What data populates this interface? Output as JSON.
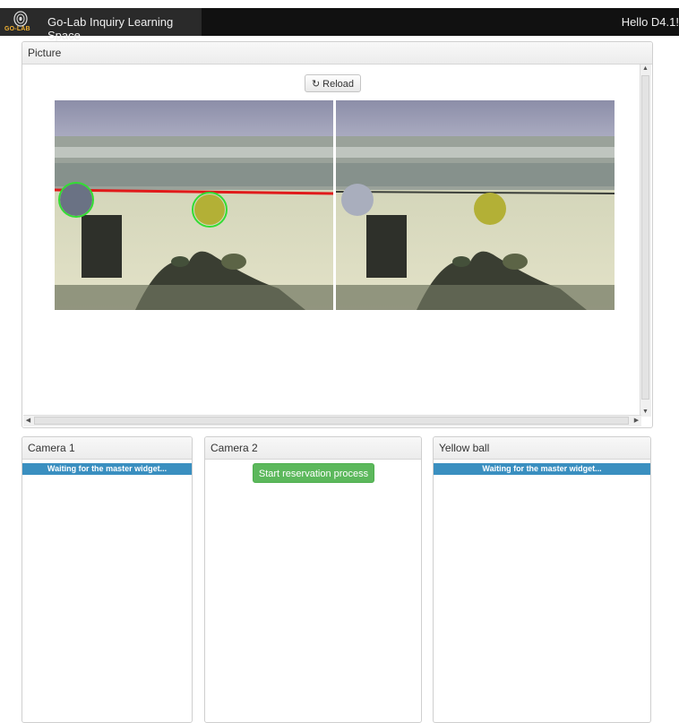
{
  "navbar": {
    "logo_text": "GO-LAB",
    "title": "Go-Lab Inquiry Learning Space",
    "greeting": "Hello D4.1!"
  },
  "picture_panel": {
    "title": "Picture",
    "reload_label": "Reload",
    "images": [
      {
        "name": "annotated-camera-frame"
      },
      {
        "name": "raw-camera-frame"
      }
    ]
  },
  "camera1_panel": {
    "title": "Camera 1",
    "status": "Waiting for the master widget..."
  },
  "camera2_panel": {
    "title": "Camera 2",
    "button_label": "Start reservation process"
  },
  "yellow_panel": {
    "title": "Yellow ball",
    "status": "Waiting for the master widget..."
  },
  "colors": {
    "navbar": "#111111",
    "status_blue": "#3a8fc0",
    "button_green": "#5cb85c",
    "waterline_red": "#e01a1a",
    "detection_green": "#33dd33"
  }
}
